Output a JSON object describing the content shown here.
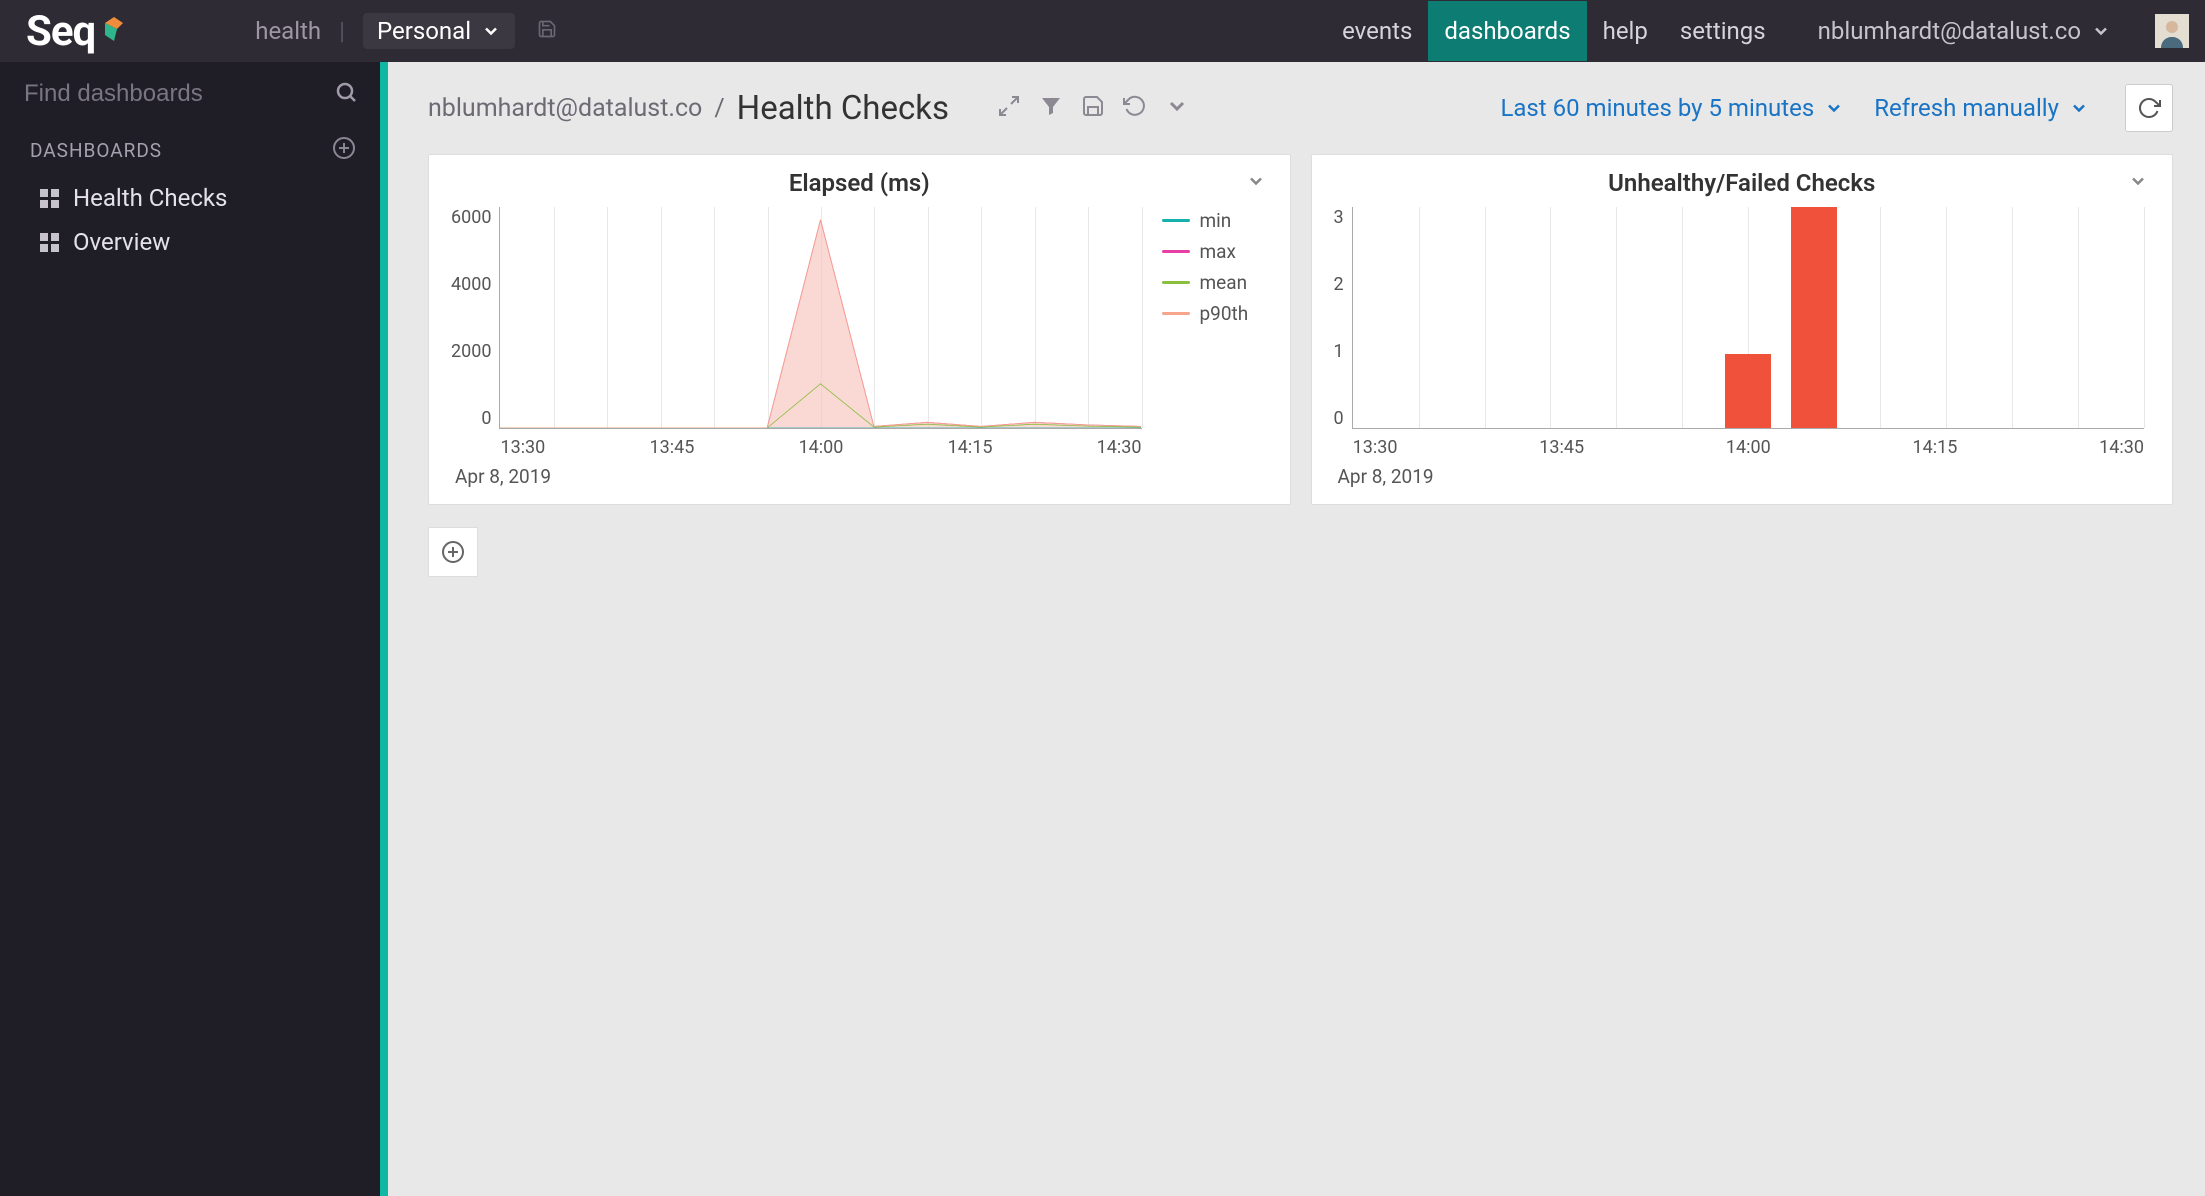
{
  "app": {
    "logo_text": "Seq"
  },
  "topnav": {
    "signal": "health",
    "selector": "Personal",
    "items": [
      {
        "key": "events",
        "label": "events",
        "active": false
      },
      {
        "key": "dashboards",
        "label": "dashboards",
        "active": true
      },
      {
        "key": "help",
        "label": "help",
        "active": false
      },
      {
        "key": "settings",
        "label": "settings",
        "active": false
      }
    ],
    "user": "nblumhardt@datalust.co"
  },
  "sidebar": {
    "search_placeholder": "Find dashboards",
    "section_title": "DASHBOARDS",
    "items": [
      {
        "label": "Health Checks"
      },
      {
        "label": "Overview"
      }
    ]
  },
  "page": {
    "owner": "nblumhardt@datalust.co",
    "separator": "/",
    "title": "Health Checks",
    "range_picker": "Last 60 minutes by 5 minutes",
    "refresh_picker": "Refresh manually"
  },
  "chart_data": [
    {
      "type": "line",
      "title": "Elapsed (ms)",
      "xlabel": "",
      "ylabel": "",
      "ylim": [
        0,
        7000
      ],
      "y_ticks": [
        0,
        2000,
        4000,
        6000
      ],
      "categories": [
        "13:30",
        "13:35",
        "13:40",
        "13:45",
        "13:50",
        "13:55",
        "14:00",
        "14:05",
        "14:10",
        "14:15",
        "14:20",
        "14:25",
        "14:30"
      ],
      "x_tick_labels": [
        "13:30",
        "13:45",
        "14:00",
        "14:15",
        "14:30"
      ],
      "date_label": "Apr 8, 2019",
      "series": [
        {
          "name": "min",
          "color": "#17b1ad",
          "values": [
            0,
            0,
            0,
            0,
            0,
            0,
            0,
            0,
            0,
            0,
            0,
            0,
            0
          ]
        },
        {
          "name": "max",
          "color": "#e73ea4",
          "values": [
            0,
            0,
            0,
            0,
            0,
            0,
            6600,
            50,
            180,
            50,
            180,
            100,
            50
          ]
        },
        {
          "name": "mean",
          "color": "#8bbf3f",
          "values": [
            0,
            0,
            0,
            0,
            0,
            0,
            1400,
            30,
            120,
            30,
            120,
            60,
            30
          ]
        },
        {
          "name": "p90th",
          "color": "#f7a58c",
          "values": [
            0,
            0,
            0,
            0,
            0,
            0,
            6600,
            50,
            180,
            50,
            180,
            100,
            50
          ]
        }
      ]
    },
    {
      "type": "bar",
      "title": "Unhealthy/Failed Checks",
      "xlabel": "",
      "ylabel": "",
      "ylim": [
        0,
        3
      ],
      "y_ticks": [
        0,
        1,
        2,
        3
      ],
      "categories": [
        "13:30",
        "13:35",
        "13:40",
        "13:45",
        "13:50",
        "13:55",
        "14:00",
        "14:05",
        "14:10",
        "14:15",
        "14:20",
        "14:25",
        "14:30"
      ],
      "x_tick_labels": [
        "13:30",
        "13:45",
        "14:00",
        "14:15",
        "14:30"
      ],
      "date_label": "Apr 8, 2019",
      "color": "#f0513b",
      "values": [
        0,
        0,
        0,
        0,
        0,
        0,
        1,
        3,
        0,
        0,
        0,
        0,
        0
      ]
    }
  ]
}
